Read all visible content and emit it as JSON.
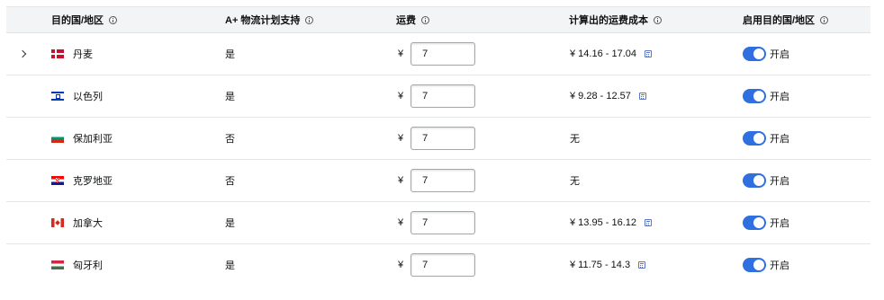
{
  "headers": {
    "country": "目的国/地区",
    "aplus": "A+ 物流计划支持",
    "fee": "运费",
    "cost": "计算出的运费成本",
    "enable": "启用目的国/地区"
  },
  "currency_symbol": "¥",
  "toggle_on_label": "开启",
  "rows": [
    {
      "country": "丹麦",
      "flag": "flag-denmark",
      "aplus": "是",
      "fee_value": "7",
      "cost": "¥  14.16 - 17.04",
      "has_calc": true,
      "enabled": true,
      "expandable": true
    },
    {
      "country": "以色列",
      "flag": "flag-israel",
      "aplus": "是",
      "fee_value": "7",
      "cost": "¥  9.28 - 12.57",
      "has_calc": true,
      "enabled": true,
      "expandable": false
    },
    {
      "country": "保加利亚",
      "flag": "flag-bulgaria",
      "aplus": "否",
      "fee_value": "7",
      "cost": "无",
      "has_calc": false,
      "enabled": true,
      "expandable": false
    },
    {
      "country": "克罗地亚",
      "flag": "flag-croatia",
      "aplus": "否",
      "fee_value": "7",
      "cost": "无",
      "has_calc": false,
      "enabled": true,
      "expandable": false
    },
    {
      "country": "加拿大",
      "flag": "flag-canada",
      "aplus": "是",
      "fee_value": "7",
      "cost": "¥  13.95 - 16.12",
      "has_calc": true,
      "enabled": true,
      "expandable": false
    },
    {
      "country": "匈牙利",
      "flag": "flag-hungary",
      "aplus": "是",
      "fee_value": "7",
      "cost": "¥  11.75 - 14.3",
      "has_calc": true,
      "enabled": true,
      "expandable": false
    }
  ],
  "colors": {
    "toggle_on": "#2f6fe0",
    "header_bg": "#f2f4f5",
    "calc_icon": "#5a76c4"
  }
}
